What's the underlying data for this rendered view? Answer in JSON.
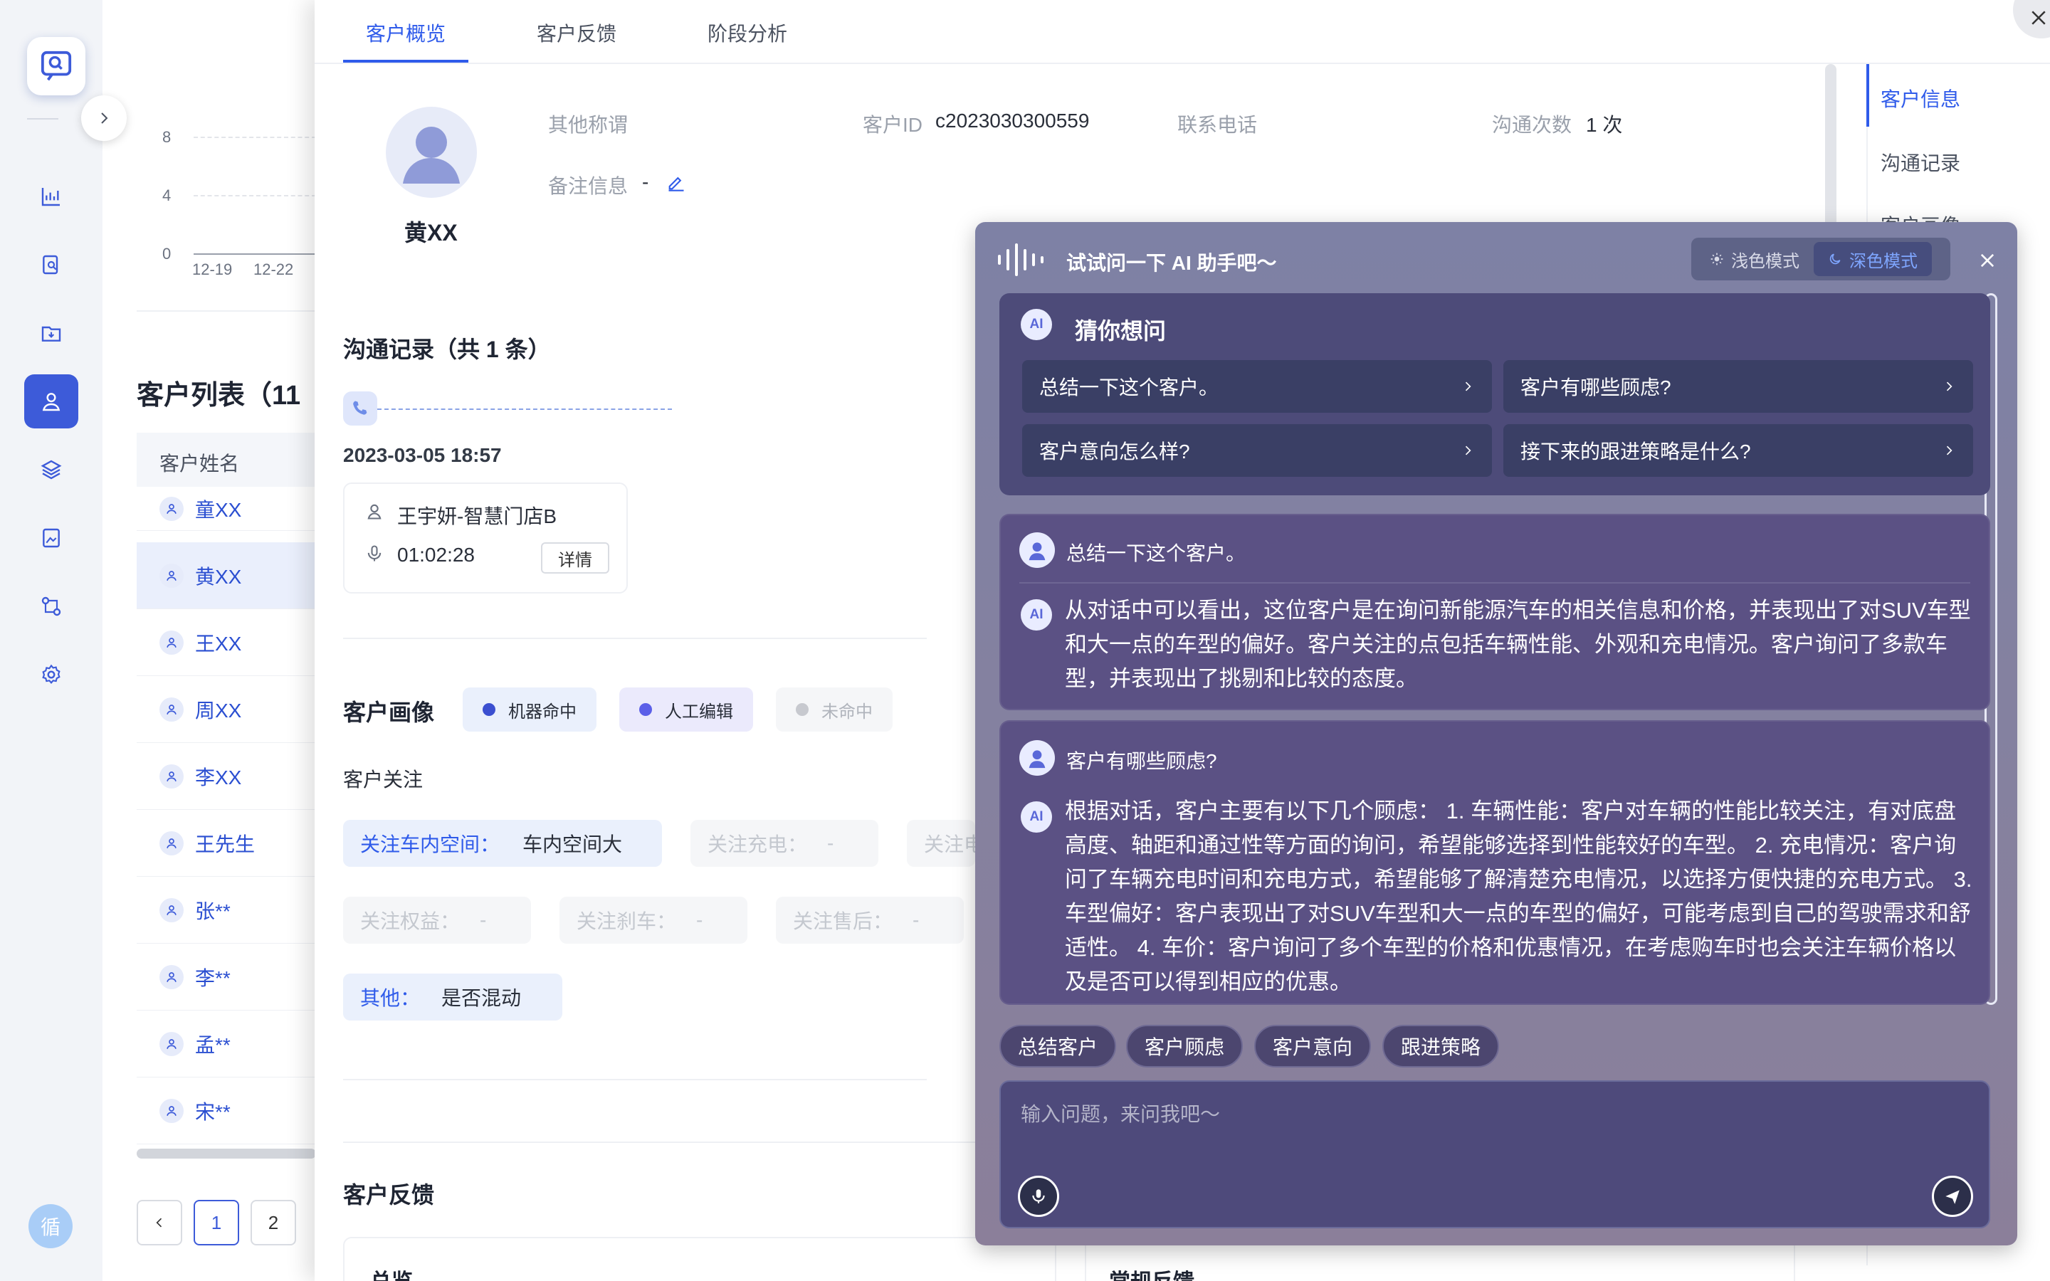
{
  "list": {
    "title": "客户列表（11",
    "header": "客户姓名",
    "rows": [
      "童XX",
      "黄XX",
      "王XX",
      "周XX",
      "李XX",
      "王先生",
      "张**",
      "李**",
      "孟**",
      "宋**"
    ],
    "chart_y": [
      "8",
      "4",
      "0"
    ],
    "chart_x": [
      "12-19",
      "12-22"
    ],
    "pages": [
      "1",
      "2"
    ]
  },
  "tabs": [
    "客户概览",
    "客户反馈",
    "阶段分析"
  ],
  "customer": {
    "name": "黄XX",
    "alias_label": "其他称谓",
    "id_label": "客户ID",
    "id_value": "c2023030300559",
    "phone_label": "联系电话",
    "count_label": "沟通次数",
    "count_value": "1 次",
    "note_label": "备注信息",
    "note_value": "-"
  },
  "records": {
    "title": "沟通记录（共 1 条）",
    "date": "2023-03-05 18:57",
    "agent": "王宇妍-智慧门店B",
    "duration": "01:02:28",
    "detail_btn": "详情"
  },
  "portrait": {
    "title": "客户画像",
    "legend": [
      "机器命中",
      "人工编辑",
      "未命中"
    ],
    "focus_title": "客户关注",
    "tags": [
      {
        "label": "关注车内空间：",
        "value": "车内空间大"
      },
      {
        "label": "关注充电：",
        "value": "-"
      },
      {
        "label": "关注电",
        "value": ""
      },
      {
        "label": "关注权益：",
        "value": "-"
      },
      {
        "label": "关注刹车：",
        "value": "-"
      },
      {
        "label": "关注售后：",
        "value": "-"
      },
      {
        "label": "其他：",
        "value": "是否混动"
      }
    ]
  },
  "feedback": {
    "title": "客户反馈",
    "left_card": "总览",
    "right_card": "常规反馈"
  },
  "anchors": [
    "客户信息",
    "沟通记录",
    "客户画像"
  ],
  "ai": {
    "title": "试试问一下 AI 助手吧～",
    "modes": [
      "浅色模式",
      "深色模式"
    ],
    "badge": "AI",
    "guess_title": "猜你想问",
    "questions": [
      "总结一下这个客户。",
      "客户有哪些顾虑?",
      "客户意向怎么样?",
      "接下来的跟进策略是什么?"
    ],
    "convs": [
      {
        "q": "总结一下这个客户。",
        "a": "从对话中可以看出，这位客户是在询问新能源汽车的相关信息和价格，并表现出了对SUV车型和大一点的车型的偏好。客户关注的点包括车辆性能、外观和充电情况。客户询问了多款车型，并表现出了挑剔和比较的态度。"
      },
      {
        "q": "客户有哪些顾虑?",
        "a": "根据对话，客户主要有以下几个顾虑： 1. 车辆性能：客户对车辆的性能比较关注，有对底盘高度、轴距和通过性等方面的询问，希望能够选择到性能较好的车型。 2. 充电情况：客户询问了车辆充电时间和充电方式，希望能够了解清楚充电情况，以选择方便快捷的充电方式。 3. 车型偏好：客户表现出了对SUV车型和大一点的车型的偏好，可能考虑到自己的驾驶需求和舒适性。 4. 车价：客户询问了多个车型的价格和优惠情况，在考虑购车时也会关注车辆价格以及是否可以得到相应的优惠。"
      }
    ],
    "suggestions": [
      "总结客户",
      "客户顾虑",
      "客户意向",
      "跟进策略"
    ],
    "input_placeholder": "输入问题，来问我吧～"
  },
  "colors": {
    "accent": "#2f5bea",
    "nav_active": "#3d5bd9",
    "machine": "#3b4fd0",
    "manual": "#5b5fe8",
    "missed": "#c7c9cf"
  }
}
